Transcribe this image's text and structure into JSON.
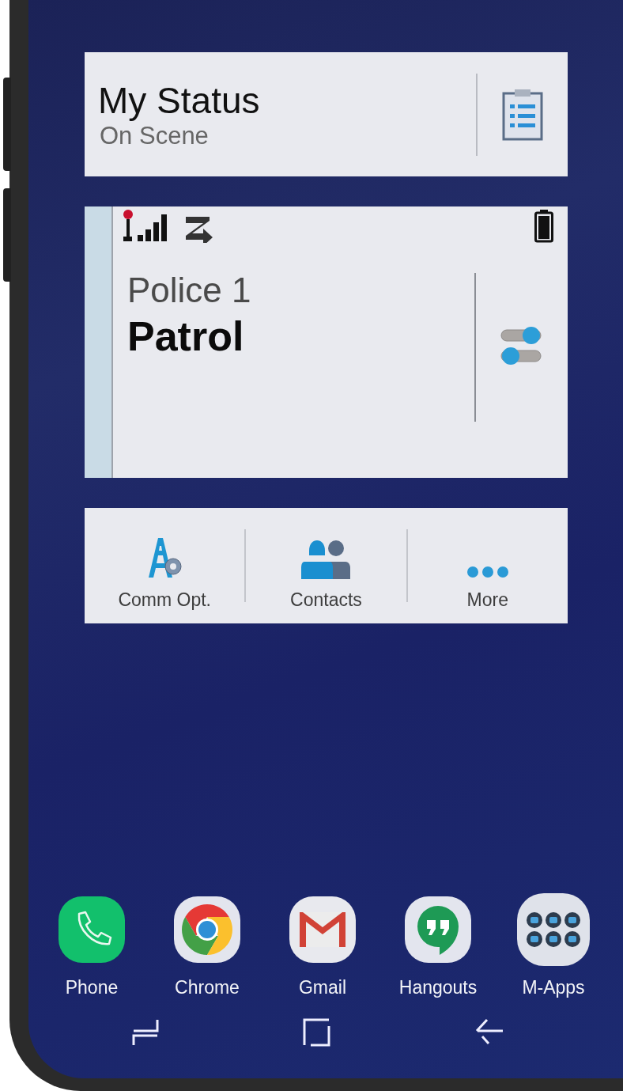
{
  "status_card": {
    "title": "My Status",
    "subtitle": "On Scene"
  },
  "unit_card": {
    "name": "Police 1",
    "status": "Patrol"
  },
  "quick_actions": [
    {
      "kind": "comm",
      "label": "Comm Opt."
    },
    {
      "kind": "contacts",
      "label": "Contacts"
    },
    {
      "kind": "more",
      "label": "More"
    }
  ],
  "dock": [
    {
      "kind": "phone",
      "label": "Phone"
    },
    {
      "kind": "chrome",
      "label": "Chrome"
    },
    {
      "kind": "gmail",
      "label": "Gmail"
    },
    {
      "kind": "hangouts",
      "label": "Hangouts"
    },
    {
      "kind": "mapps",
      "label": "M-Apps"
    }
  ]
}
